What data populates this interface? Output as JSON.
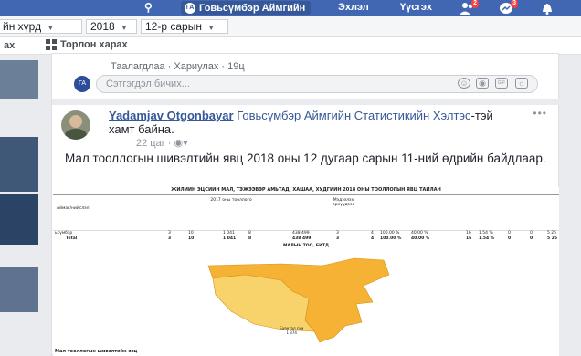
{
  "topbar": {
    "page_name": "Говьсүмбэр Аймгийн",
    "nav_home": "Эхлэл",
    "nav_create": "Үүсгэх",
    "badge_notifications": "2",
    "badge_messages": "3"
  },
  "filters": {
    "district": "йн хүрд",
    "year": "2018",
    "month": "12-р сарын"
  },
  "tabs": {
    "left_tab": "ах",
    "grid_tab": "Торлон харах"
  },
  "previous_post": {
    "actions": "Таалагдлаа · Хариулах · 19ц"
  },
  "comment_box": {
    "placeholder": "Сэтгэгдэл бичих..."
  },
  "post": {
    "author": "Yadamjav Otgonbayar",
    "page": "Говьсүмбэр Аймгийн Статистикийн Хэлтэс",
    "suffix": "-тэй хамт байна.",
    "time": "22 цаг · ",
    "text": "Мал тооллогын шивэлтийн явц 2018 оны 12 дугаар сарын 11-ний өдрийн байдлаар."
  },
  "document": {
    "title": "ЖИЛИЙН ЭЦСИЙН МАЛ, ТЭЖЭЭВЭР АМЬТАД, ХАШАА, ХУДГИЙН 2018 ОНЫ ТООЛЛОГЫН ЯВЦ ТАЙЛАН",
    "col_region": "Аймаг/нийслэл",
    "col_year_group": "2017 оны тооллого",
    "col_enumerated": "Мэдээлэх өрхүүдээс",
    "rows": [
      {
        "name": "ьсүмбэр",
        "a": "3",
        "b": "10",
        "c": "1 041",
        "d": "8",
        "e": "438 499",
        "f": "3",
        "g": "4",
        "h": "100.00 %",
        "i": "40.00 %",
        "j": "16",
        "k": "1.54 %",
        "l": "0",
        "m": "0",
        "n": "5 25"
      },
      {
        "name": "Total",
        "a": "3",
        "b": "10",
        "c": "1 041",
        "d": "8",
        "e": "438 499",
        "f": "3",
        "g": "4",
        "h": "100.00 %",
        "i": "40.00 %",
        "j": "16",
        "k": "1.54 %",
        "l": "0",
        "m": "0",
        "n": "5 25"
      }
    ],
    "map_title": "МАЛЫН ТОО, БИТД",
    "map_label": "Баянтал сум",
    "map_label_value": "1 374",
    "table2_title": "Мал тооллогын шивэлтийн явц"
  },
  "colors": {
    "facebook_blue": "#4267b2",
    "map_orange": "#f5a623",
    "map_yellow": "#f8d36b"
  }
}
